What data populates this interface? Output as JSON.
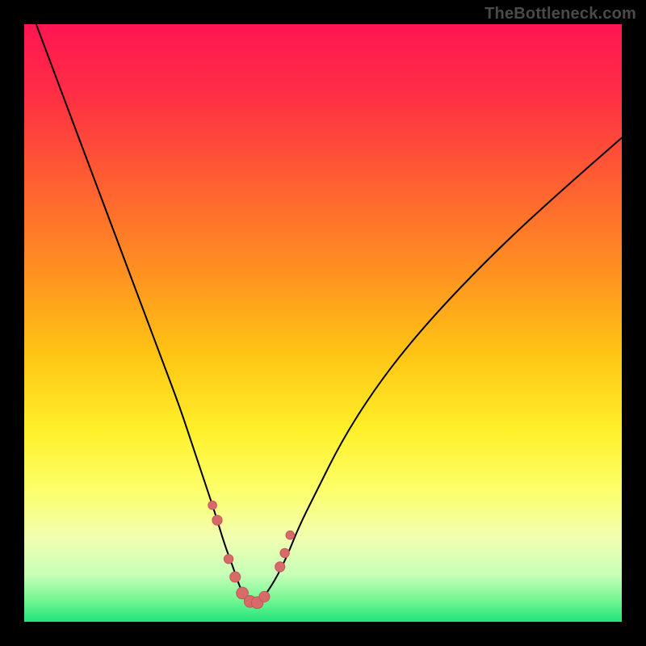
{
  "watermark": "TheBottleneck.com",
  "colors": {
    "frame": "#000000",
    "watermark": "#4a4a4a",
    "curve": "#000000",
    "markerFill": "#d86a6a",
    "markerStroke": "#c05858",
    "gradientStops": [
      {
        "offset": 0.0,
        "color": "#ff1552"
      },
      {
        "offset": 0.12,
        "color": "#ff2f44"
      },
      {
        "offset": 0.25,
        "color": "#ff5a33"
      },
      {
        "offset": 0.4,
        "color": "#ff8c22"
      },
      {
        "offset": 0.55,
        "color": "#ffc414"
      },
      {
        "offset": 0.68,
        "color": "#fff029"
      },
      {
        "offset": 0.78,
        "color": "#fdff6b"
      },
      {
        "offset": 0.86,
        "color": "#f0ffb0"
      },
      {
        "offset": 0.92,
        "color": "#c8ffb8"
      },
      {
        "offset": 0.96,
        "color": "#7cf796"
      },
      {
        "offset": 1.0,
        "color": "#22e37a"
      }
    ]
  },
  "chart_data": {
    "type": "line",
    "title": "",
    "xlabel": "",
    "ylabel": "",
    "xlim": [
      0,
      100
    ],
    "ylim": [
      0,
      100
    ],
    "series": [
      {
        "name": "bottleneck-curve",
        "x": [
          2,
          5,
          8,
          11,
          14,
          17,
          20,
          23,
          26,
          28,
          30,
          32,
          33.5,
          35,
          36,
          37,
          38,
          39,
          40,
          42,
          44,
          46,
          49,
          53,
          58,
          64,
          72,
          82,
          92,
          100
        ],
        "y": [
          100,
          92,
          84,
          76,
          68,
          60,
          52,
          44,
          36,
          30,
          24,
          18,
          13,
          9,
          6,
          4,
          3,
          3,
          4,
          7,
          11,
          16,
          22,
          30,
          38,
          46,
          55,
          65,
          74,
          81
        ]
      }
    ],
    "markers": {
      "name": "highlighted-points",
      "x": [
        31.5,
        32.3,
        34.2,
        35.3,
        36.5,
        37.8,
        39.0,
        40.2,
        42.8,
        43.6,
        44.5
      ],
      "y": [
        19.5,
        17.0,
        10.5,
        7.5,
        4.8,
        3.4,
        3.2,
        4.2,
        9.2,
        11.5,
        14.5
      ],
      "radius": [
        1.3,
        1.5,
        1.4,
        1.6,
        1.8,
        1.8,
        1.8,
        1.6,
        1.5,
        1.4,
        1.3
      ]
    }
  }
}
